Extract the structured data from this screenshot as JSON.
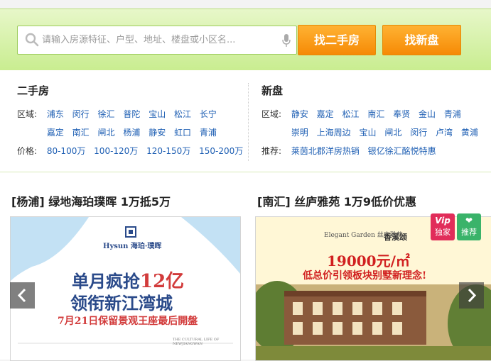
{
  "search": {
    "placeholder": "请输入房源特征、户型、地址、楼盘或小区名...",
    "btn_second_hand": "找二手房",
    "btn_new_house": "找新盘"
  },
  "second_hand": {
    "title": "二手房",
    "area_label": "区域:",
    "areas_row1": [
      "浦东",
      "闵行",
      "徐汇",
      "普陀",
      "宝山",
      "松江",
      "长宁"
    ],
    "areas_row2": [
      "嘉定",
      "南汇",
      "闸北",
      "杨浦",
      "静安",
      "虹口",
      "青浦"
    ],
    "price_label": "价格:",
    "prices": [
      "80-100万",
      "100-120万",
      "120-150万",
      "150-200万"
    ]
  },
  "new_house": {
    "title": "新盘",
    "area_label": "区域:",
    "areas_row1": [
      "静安",
      "嘉定",
      "松江",
      "南汇",
      "奉贤",
      "金山",
      "青浦"
    ],
    "areas_row2": [
      "崇明",
      "上海周边",
      "宝山",
      "闸北",
      "闵行",
      "卢湾",
      "黄浦"
    ],
    "rec_label": "推荐:",
    "recs": [
      "莱茵北郡洋房热销",
      "银亿徐汇酩悦特惠"
    ]
  },
  "cards": {
    "left_title": "[杨浦] 绿地海珀璞晖 1万抵5万",
    "right_title": "[南汇] 丝庐雅苑 1万9低价优惠"
  },
  "left_poster": {
    "brand": "Hysun 海珀·璞晖",
    "line1": "单月疯抢",
    "line1_num": "12亿",
    "line2": "领衔新江湾城",
    "line3": "7月21日保留景观王座最后開盤",
    "footer": "THE CULTURAL LIFE OF NEWJIANGWAN"
  },
  "right_poster": {
    "brand": "Elegant Garden 丝庐雅苑",
    "brand_cn2": "香溪颂",
    "price": "19000元/㎡",
    "slogan": "低总价引领板块别墅新理念!"
  },
  "badges": {
    "vip_top": "Vip",
    "vip_bottom": "独家",
    "rec_top": "❤",
    "rec_bottom": "推荐"
  },
  "colors": {
    "link": "#1d5eb3",
    "button": "#f68a05",
    "search_band": "#c9ed90"
  }
}
